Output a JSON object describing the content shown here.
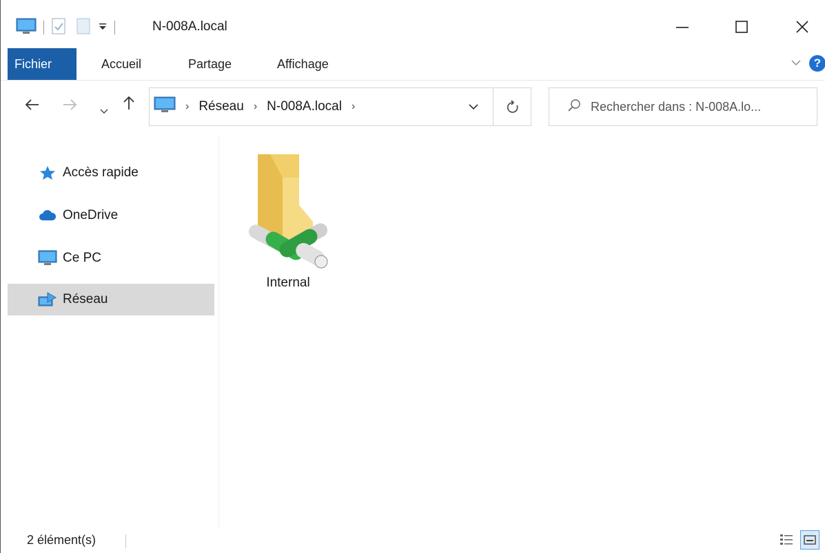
{
  "window": {
    "title": "N-008A.local"
  },
  "ribbon": {
    "tabs": [
      {
        "label": "Fichier"
      },
      {
        "label": "Accueil"
      },
      {
        "label": "Partage"
      },
      {
        "label": "Affichage"
      }
    ],
    "help_label": "?"
  },
  "nav": {
    "breadcrumb": [
      "Réseau",
      "N-008A.local"
    ],
    "search_placeholder": "Rechercher dans : N-008A.lo..."
  },
  "sidebar": {
    "items": [
      {
        "label": "Accès rapide",
        "icon": "star-icon"
      },
      {
        "label": "OneDrive",
        "icon": "cloud-icon"
      },
      {
        "label": "Ce PC",
        "icon": "computer-icon"
      },
      {
        "label": "Réseau",
        "icon": "network-icon",
        "selected": true
      }
    ]
  },
  "content": {
    "items": [
      {
        "label": "Internal",
        "icon": "network-share-folder-icon"
      }
    ]
  },
  "status": {
    "count": "2 élément(s)"
  },
  "colors": {
    "file_tab": "#1b5fa8",
    "selection": "#d9d9d9",
    "accent": "#1e6fd1"
  }
}
